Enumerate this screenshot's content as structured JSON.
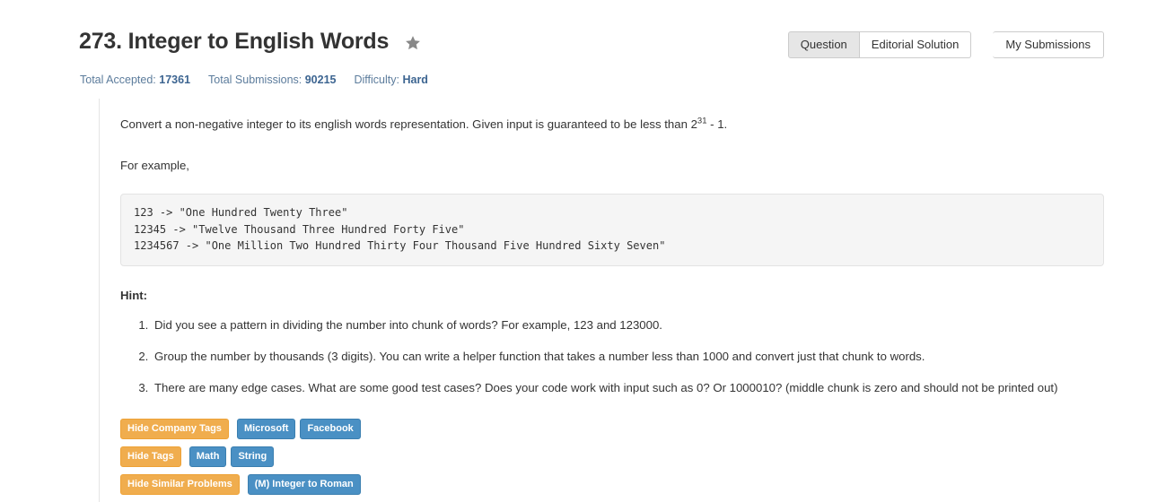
{
  "header": {
    "problem_title": "273. Integer to English Words",
    "star_icon": "star-icon",
    "stats": {
      "accepted_label": "Total Accepted:",
      "accepted_value": "17361",
      "submissions_label": "Total Submissions:",
      "submissions_value": "90215",
      "difficulty_label": "Difficulty:",
      "difficulty_value": "Hard"
    },
    "buttons": {
      "question": "Question",
      "editorial_solution": "Editorial Solution",
      "my_submissions": "My Submissions"
    }
  },
  "main": {
    "description_part1": "Convert a non-negative integer to its english words representation. Given input is guaranteed to be less than 2",
    "description_exponent": "31",
    "description_part2": " - 1.",
    "for_example": "For example,",
    "code_example": "123 -> \"One Hundred Twenty Three\"\n12345 -> \"Twelve Thousand Three Hundred Forty Five\"\n1234567 -> \"One Million Two Hundred Thirty Four Thousand Five Hundred Sixty Seven\"",
    "hint_label": "Hint:",
    "hints": [
      "Did you see a pattern in dividing the number into chunk of words? For example, 123 and 123000.",
      "Group the number by thousands (3 digits). You can write a helper function that takes a number less than 1000 and convert just that chunk to words.",
      "There are many edge cases. What are some good test cases? Does your code work with input such as 0? Or 1000010? (middle chunk is zero and should not be printed out)"
    ],
    "tag_rows": [
      {
        "toggle": "Hide Company Tags",
        "tags": [
          "Microsoft",
          "Facebook"
        ]
      },
      {
        "toggle": "Hide Tags",
        "tags": [
          "Math",
          "String"
        ]
      },
      {
        "toggle": "Hide Similar Problems",
        "tags": [
          "(M) Integer to Roman"
        ]
      }
    ]
  },
  "colors": {
    "tag_orange": "#f0ad4e",
    "tag_blue": "#4a90c4",
    "stat_link": "#5c7c9c",
    "stat_value": "#3d6591",
    "code_bg": "#f5f5f5",
    "button_active_bg": "#e6e6e6"
  }
}
